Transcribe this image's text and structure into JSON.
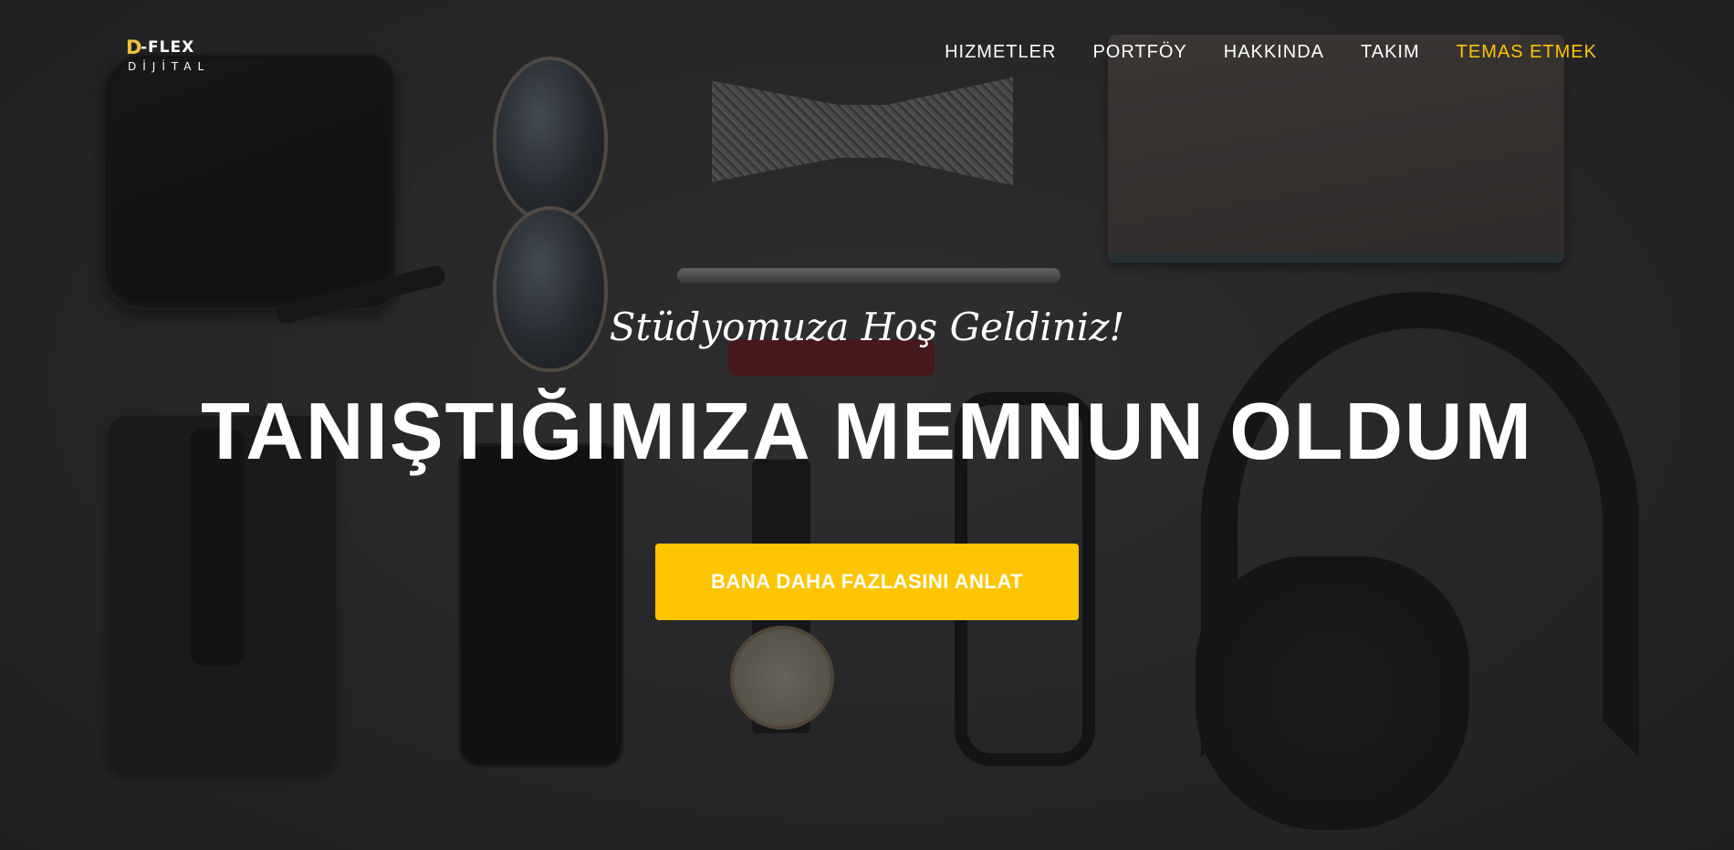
{
  "brand": {
    "logo_mark": "D",
    "logo_top": "-FLEX",
    "logo_bottom": "DİJİTAL",
    "accent_color": "#fec503"
  },
  "nav": {
    "items": [
      {
        "label": "HIZMETLER",
        "active": false
      },
      {
        "label": "PORTFÖY",
        "active": false
      },
      {
        "label": "HAKKINDA",
        "active": false
      },
      {
        "label": "TAKIM",
        "active": false
      },
      {
        "label": "TEMAS ETMEK",
        "active": true
      }
    ]
  },
  "hero": {
    "subtitle": "Stüdyomuza Hoş Geldiniz!",
    "headline": "TANIŞTIĞIMIZA MEMNUN OLDUM",
    "cta_label": "BANA DAHA FAZLASINI ANLAT",
    "background": "dark flat-lay photo of accessories"
  }
}
